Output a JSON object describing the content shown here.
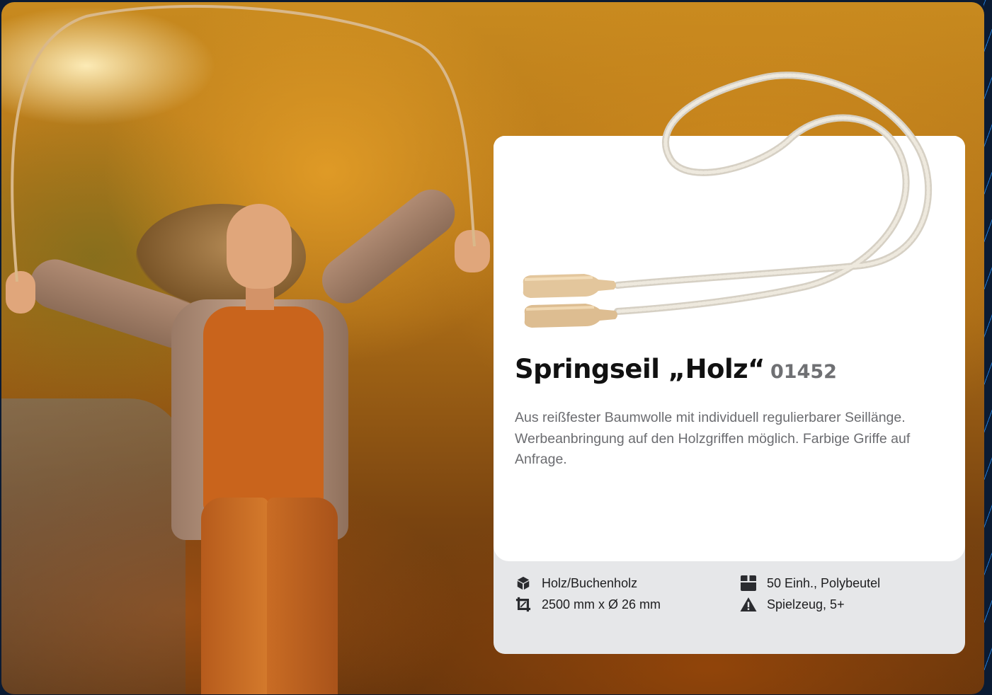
{
  "product": {
    "title": "Springseil „Holz“",
    "article_number": "01452",
    "description": "Aus reißfester Baumwolle mit individuell regulierbarer Seillänge. Werbeanbringung auf den Holzgriffen möglich. Farbige Griffe auf Anfrage.",
    "specs": {
      "material": {
        "icon": "box-icon",
        "label": "Holz/Buchenholz"
      },
      "packaging": {
        "icon": "package-icon",
        "label": "50 Einh., Polybeutel"
      },
      "dimensions": {
        "icon": "crop-icon",
        "label": "2500 mm x Ø 26 mm"
      },
      "safety": {
        "icon": "warning-icon",
        "label": "Spielzeug, 5+"
      }
    }
  },
  "colors": {
    "frame_background": "#0b1b33",
    "accent_lines": "#1f7ad6",
    "card_background": "#ffffff",
    "card_footer": "#e6e7e9",
    "title_color": "#111111",
    "article_number_color": "#6f7073",
    "description_color": "#6b6c70"
  }
}
